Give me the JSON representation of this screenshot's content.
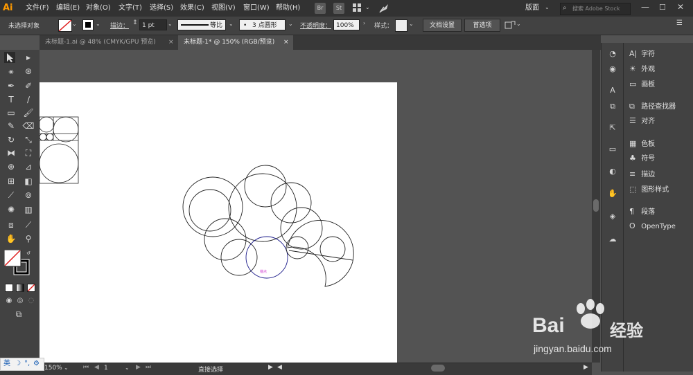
{
  "app": {
    "logo": "Ai",
    "brand_color": "#ff9a00"
  },
  "menu": [
    "文件(F)",
    "编辑(E)",
    "对象(O)",
    "文字(T)",
    "选择(S)",
    "效果(C)",
    "视图(V)",
    "窗口(W)",
    "帮助(H)"
  ],
  "menu_icons": [
    "Br",
    "St"
  ],
  "workspace_label": "版面",
  "search": {
    "placeholder": "搜索 Adobe Stock"
  },
  "control": {
    "selection": "未选择对象",
    "stroke_label": "描边：",
    "stroke_value": "1 pt",
    "profile": "等比",
    "brush": "3 点圆形",
    "opacity_label": "不透明度：",
    "opacity_value": "100%",
    "style_label": "样式：",
    "doc_settings": "文档设置",
    "preferences": "首选项"
  },
  "tabs": [
    {
      "label": "未标题-1.ai @ 48% (CMYK/GPU 预览)",
      "active": false
    },
    {
      "label": "未标题-1* @ 150% (RGB/预览)",
      "active": true
    }
  ],
  "panels": [
    {
      "icon": "A|",
      "label": "字符"
    },
    {
      "icon": "☀",
      "label": "外观"
    },
    {
      "icon": "▭",
      "label": "画板"
    },
    {
      "icon": "⧉",
      "label": "路径查找器"
    },
    {
      "icon": "☰",
      "label": "对齐"
    },
    {
      "icon": "▦",
      "label": "色板"
    },
    {
      "icon": "♣",
      "label": "符号"
    },
    {
      "icon": "≡",
      "label": "描边"
    },
    {
      "icon": "⬚",
      "label": "图形样式"
    },
    {
      "icon": "¶",
      "label": "段落"
    },
    {
      "icon": "O",
      "label": "OpenType"
    }
  ],
  "status": {
    "zoom": "150%",
    "page": "1",
    "tool": "直接选择"
  },
  "ime": {
    "label": "英"
  },
  "watermark": {
    "brand": "Bai",
    "brand2": "经验",
    "url": "jingyan.baidu.com"
  },
  "canvas": {
    "anchor_label": "锚点"
  }
}
